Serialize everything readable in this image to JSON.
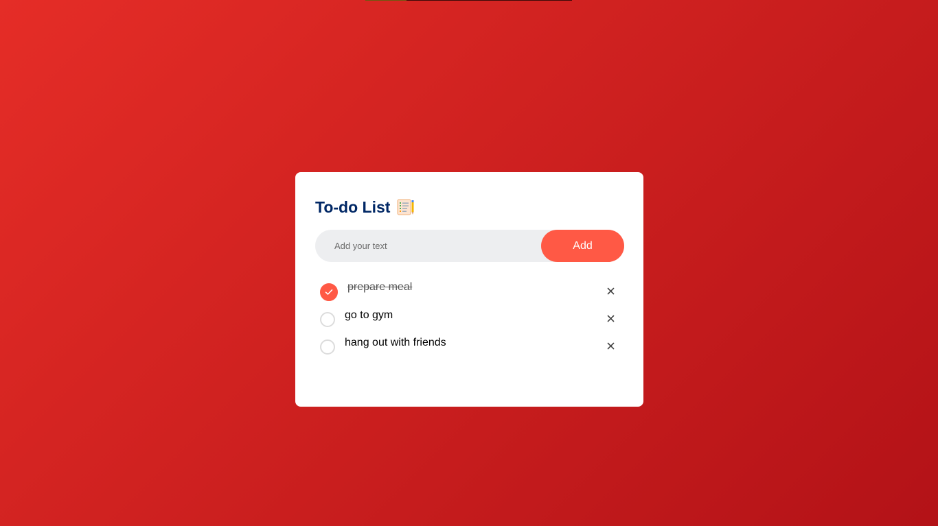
{
  "app": {
    "title": "To-do List",
    "title_icon": "notepad-checklist-icon"
  },
  "input": {
    "value": "",
    "placeholder": "Add your text"
  },
  "add_button": {
    "label": "Add"
  },
  "tasks": [
    {
      "text": "prepare meal",
      "completed": true
    },
    {
      "text": "go to gym",
      "completed": false
    },
    {
      "text": "hang out with friends",
      "completed": false
    }
  ],
  "colors": {
    "background_start": "#e52d27",
    "background_end": "#b31217",
    "accent": "#ff5945",
    "title": "#002765",
    "input_bg": "#edeef0"
  },
  "icons": {
    "check": "check-icon",
    "remove": "close-icon"
  }
}
